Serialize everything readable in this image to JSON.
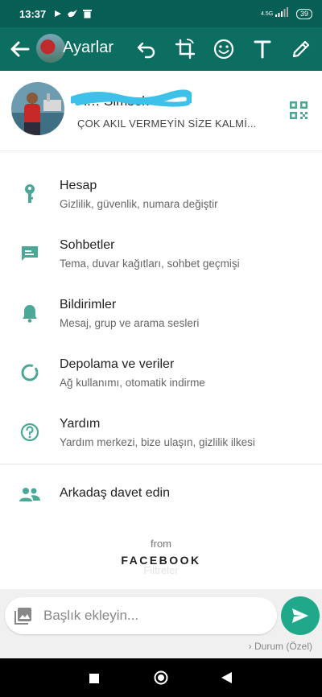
{
  "status": {
    "time": "13:37",
    "network": "4.5G",
    "battery": "39"
  },
  "appbar": {
    "title": "Ayarlar"
  },
  "profile": {
    "name": "A… Simsek",
    "about": "ÇOK AKIL VERMEYİN SİZE KALMİ..."
  },
  "settings": [
    {
      "title": "Hesap",
      "subtitle": "Gizlilik, güvenlik, numara değiştir"
    },
    {
      "title": "Sohbetler",
      "subtitle": "Tema, duvar kağıtları, sohbet geçmişi"
    },
    {
      "title": "Bildirimler",
      "subtitle": "Mesaj, grup ve arama sesleri"
    },
    {
      "title": "Depolama ve veriler",
      "subtitle": "Ağ kullanımı, otomatik indirme"
    },
    {
      "title": "Yardım",
      "subtitle": "Yardım merkezi, bize ulaşın, gizlilik ilkesi"
    }
  ],
  "invite": {
    "title": "Arkadaş davet edin"
  },
  "footer": {
    "from": "from",
    "brand": "FACEBOOK",
    "filters": "Filtreler"
  },
  "caption": {
    "placeholder": "Başlık ekleyin..."
  },
  "status_selector": "Durum (Özel)",
  "colors": {
    "header": "#075e54",
    "accent": "#1fa88a",
    "icon": "#4aa896"
  }
}
